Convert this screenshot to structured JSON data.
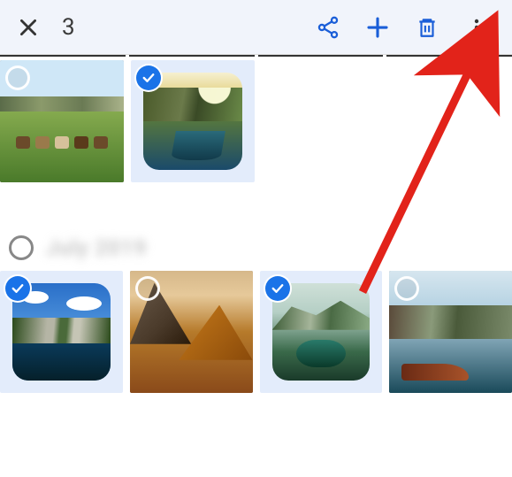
{
  "header": {
    "selected_count": "3",
    "actions": {
      "share": "share",
      "add": "add",
      "delete": "delete",
      "more": "more"
    }
  },
  "section2": {
    "label": "July 2019"
  },
  "photos_row1": [
    {
      "selected": false,
      "desc": "pasture-cows"
    },
    {
      "selected": true,
      "desc": "mountain-valley-river"
    }
  ],
  "photos_row2": [
    {
      "selected": true,
      "desc": "alpine-lake-reflection"
    },
    {
      "selected": false,
      "desc": "autumn-mountain"
    },
    {
      "selected": true,
      "desc": "green-valley-pond"
    },
    {
      "selected": false,
      "desc": "lake-boat"
    }
  ],
  "accent": "#1a73e8",
  "annotation": {
    "arrow_target": "more-button"
  }
}
